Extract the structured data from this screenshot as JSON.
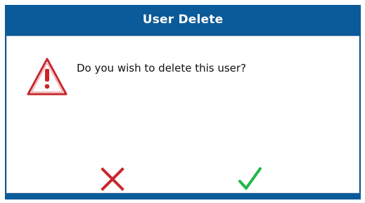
{
  "dialog": {
    "title": "User Delete",
    "message": "Do you wish to delete this user?",
    "icon": "warning-icon",
    "cancel_icon": "close-icon",
    "confirm_icon": "check-icon",
    "colors": {
      "titlebar": "#0b5a99",
      "title_text": "#ffffff",
      "warning": "#c8262b",
      "cancel": "#c8262b",
      "confirm": "#22b84a"
    }
  }
}
